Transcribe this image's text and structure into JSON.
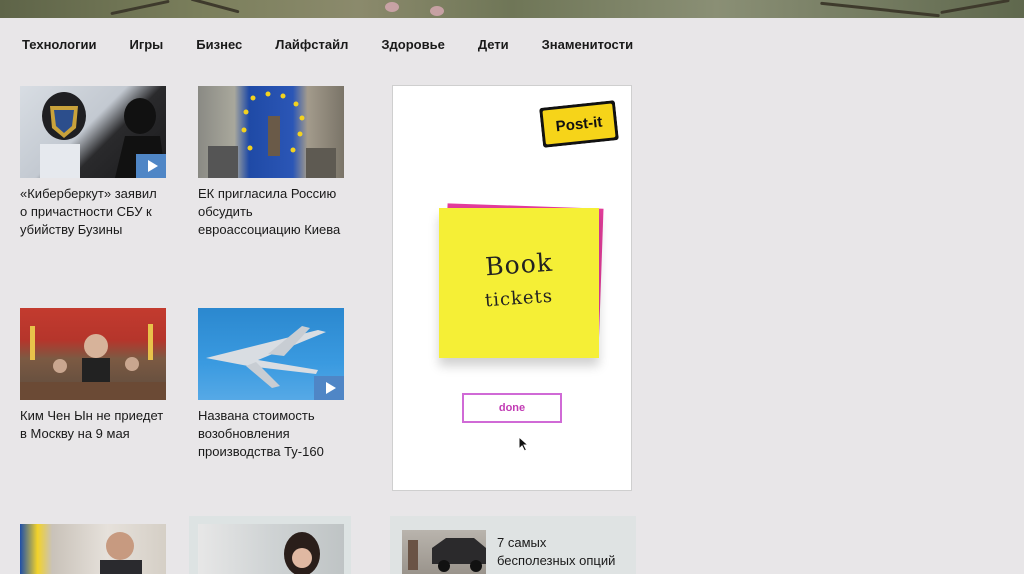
{
  "nav": {
    "items": [
      "Технологии",
      "Игры",
      "Бизнес",
      "Лайфстайл",
      "Здоровье",
      "Дети",
      "Знаменитости"
    ]
  },
  "articles": [
    {
      "title": "«Киберберкут» заявил о причастности СБУ к убийству Бузины",
      "has_video": true
    },
    {
      "title": "ЕК пригласила Россию обсудить евроассоциацию Киева",
      "has_video": false
    },
    {
      "title": "Ким Чен Ын не приедет в Москву на 9 мая",
      "has_video": false
    },
    {
      "title": "Названа стоимость возобновления производства Ту-160",
      "has_video": true
    }
  ],
  "ad": {
    "brand": "Post-it",
    "note_line1": "Book",
    "note_line2": "tickets",
    "button_label": "done"
  },
  "promo": {
    "title": "7 самых бесполезных опций"
  },
  "colors": {
    "background": "#e8e6e8",
    "play_badge": "#4f86c6",
    "note_yellow": "#f5ef36",
    "note_pink": "#e23d9a",
    "done_border": "#d06ad6"
  }
}
